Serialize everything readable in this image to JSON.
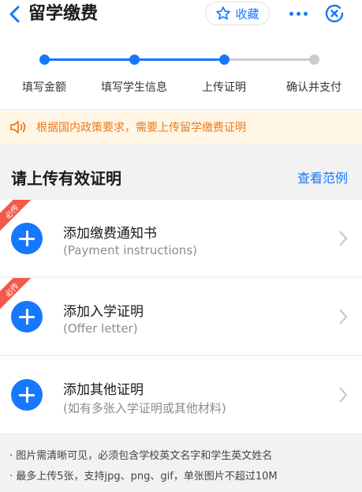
{
  "header": {
    "title": "留学缴费",
    "favorite_label": "收藏"
  },
  "stepper": {
    "current_step": 3,
    "steps": [
      {
        "label": "填写金额",
        "state": "done"
      },
      {
        "label": "填写学生信息",
        "state": "done"
      },
      {
        "label": "上传证明",
        "state": "current"
      },
      {
        "label": "确认并支付",
        "state": "pending"
      }
    ]
  },
  "notice": {
    "text": "根据国内政策要求，需要上传留学缴费证明"
  },
  "section": {
    "title": "请上传有效证明",
    "example_link": "查看范例"
  },
  "uploads": [
    {
      "title": "添加缴费通知书",
      "subtitle": "(Payment instructions)",
      "tag": "必传"
    },
    {
      "title": "添加入学证明",
      "subtitle": "(Offer letter)",
      "tag": "必传"
    },
    {
      "title": "添加其他证明",
      "subtitle": "(如有多张入学证明或其他材料)"
    }
  ],
  "tips": [
    "· 图片需清晰可见，必须包含学校英文名字和学生英文姓名",
    "· 最多上传5张，支持jpg、png、gif，单张图片不超过10M"
  ],
  "colors": {
    "accent": "#1677ff",
    "step_pending": "#cccccc",
    "notice_text": "#f07a1a",
    "notice_bg": "#fff6e6",
    "required_tag": "#f25a4a"
  }
}
